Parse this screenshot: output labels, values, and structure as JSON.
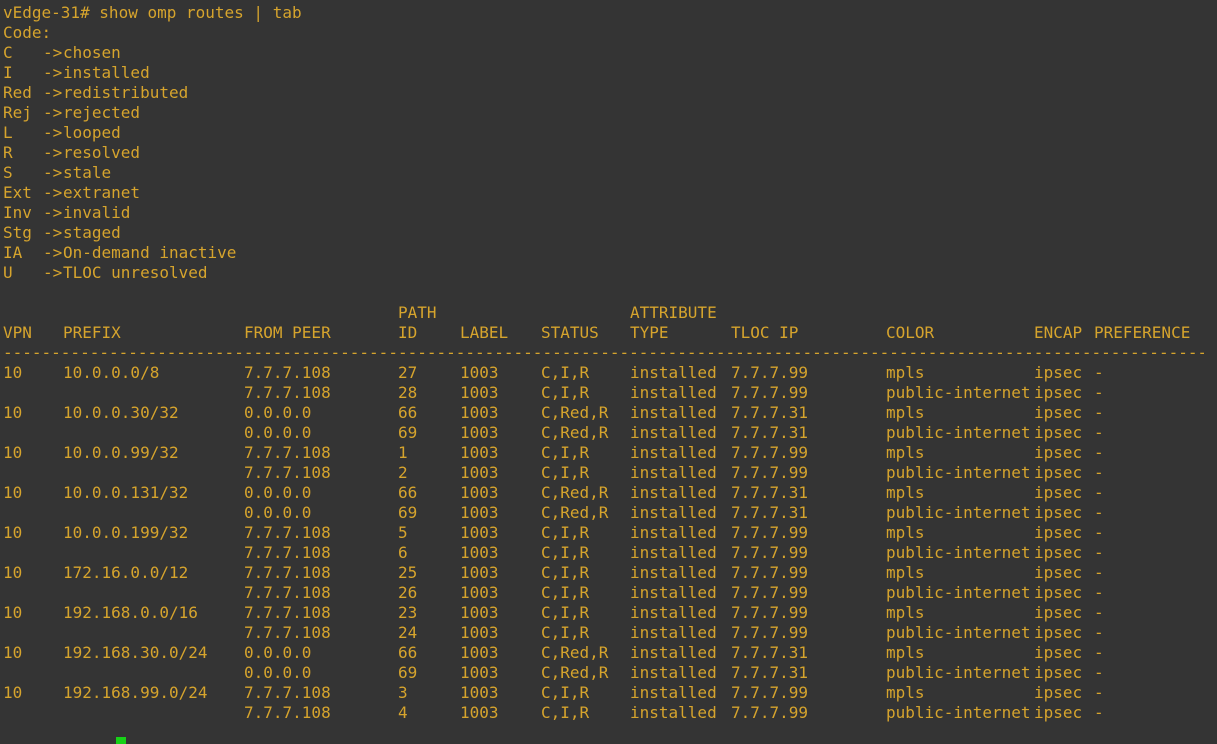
{
  "colors": {
    "background": "#343434",
    "text": "#d6a42d",
    "cursor": "#17d217"
  },
  "terminal": {
    "prompt": "vEdge-31#",
    "command": "show omp routes | tab"
  },
  "legend": {
    "title": "Code:",
    "arrow": "->",
    "entries": [
      {
        "code": "C",
        "meaning": "chosen"
      },
      {
        "code": "I",
        "meaning": "installed"
      },
      {
        "code": "Red",
        "meaning": "redistributed"
      },
      {
        "code": "Rej",
        "meaning": "rejected"
      },
      {
        "code": "L",
        "meaning": "looped"
      },
      {
        "code": "R",
        "meaning": "resolved"
      },
      {
        "code": "S",
        "meaning": "stale"
      },
      {
        "code": "Ext",
        "meaning": "extranet"
      },
      {
        "code": "Inv",
        "meaning": "invalid"
      },
      {
        "code": "Stg",
        "meaning": "staged"
      },
      {
        "code": "IA",
        "meaning": "On-demand inactive"
      },
      {
        "code": "U",
        "meaning": "TLOC unresolved"
      }
    ]
  },
  "table": {
    "header_top": {
      "path": "PATH",
      "attribute": "ATTRIBUTE"
    },
    "headers": {
      "vpn": "VPN",
      "prefix": "PREFIX",
      "from_peer": "FROM PEER",
      "path_id": "ID",
      "label": "LABEL",
      "status": "STATUS",
      "attribute_type": "TYPE",
      "tloc_ip": "TLOC IP",
      "color": "COLOR",
      "encap": "ENCAP",
      "preference": "PREFERENCE"
    },
    "separator_char": "-",
    "rows": [
      {
        "vpn": "10",
        "prefix": "10.0.0.0/8",
        "from_peer": "7.7.7.108",
        "path_id": "27",
        "label": "1003",
        "status": "C,I,R",
        "attribute_type": "installed",
        "tloc_ip": "7.7.7.99",
        "color": "mpls",
        "encap": "ipsec",
        "preference": "-"
      },
      {
        "vpn": "",
        "prefix": "",
        "from_peer": "7.7.7.108",
        "path_id": "28",
        "label": "1003",
        "status": "C,I,R",
        "attribute_type": "installed",
        "tloc_ip": "7.7.7.99",
        "color": "public-internet",
        "encap": "ipsec",
        "preference": "-"
      },
      {
        "vpn": "10",
        "prefix": "10.0.0.30/32",
        "from_peer": "0.0.0.0",
        "path_id": "66",
        "label": "1003",
        "status": "C,Red,R",
        "attribute_type": "installed",
        "tloc_ip": "7.7.7.31",
        "color": "mpls",
        "encap": "ipsec",
        "preference": "-"
      },
      {
        "vpn": "",
        "prefix": "",
        "from_peer": "0.0.0.0",
        "path_id": "69",
        "label": "1003",
        "status": "C,Red,R",
        "attribute_type": "installed",
        "tloc_ip": "7.7.7.31",
        "color": "public-internet",
        "encap": "ipsec",
        "preference": "-"
      },
      {
        "vpn": "10",
        "prefix": "10.0.0.99/32",
        "from_peer": "7.7.7.108",
        "path_id": "1",
        "label": "1003",
        "status": "C,I,R",
        "attribute_type": "installed",
        "tloc_ip": "7.7.7.99",
        "color": "mpls",
        "encap": "ipsec",
        "preference": "-"
      },
      {
        "vpn": "",
        "prefix": "",
        "from_peer": "7.7.7.108",
        "path_id": "2",
        "label": "1003",
        "status": "C,I,R",
        "attribute_type": "installed",
        "tloc_ip": "7.7.7.99",
        "color": "public-internet",
        "encap": "ipsec",
        "preference": "-"
      },
      {
        "vpn": "10",
        "prefix": "10.0.0.131/32",
        "from_peer": "0.0.0.0",
        "path_id": "66",
        "label": "1003",
        "status": "C,Red,R",
        "attribute_type": "installed",
        "tloc_ip": "7.7.7.31",
        "color": "mpls",
        "encap": "ipsec",
        "preference": "-"
      },
      {
        "vpn": "",
        "prefix": "",
        "from_peer": "0.0.0.0",
        "path_id": "69",
        "label": "1003",
        "status": "C,Red,R",
        "attribute_type": "installed",
        "tloc_ip": "7.7.7.31",
        "color": "public-internet",
        "encap": "ipsec",
        "preference": "-"
      },
      {
        "vpn": "10",
        "prefix": "10.0.0.199/32",
        "from_peer": "7.7.7.108",
        "path_id": "5",
        "label": "1003",
        "status": "C,I,R",
        "attribute_type": "installed",
        "tloc_ip": "7.7.7.99",
        "color": "mpls",
        "encap": "ipsec",
        "preference": "-"
      },
      {
        "vpn": "",
        "prefix": "",
        "from_peer": "7.7.7.108",
        "path_id": "6",
        "label": "1003",
        "status": "C,I,R",
        "attribute_type": "installed",
        "tloc_ip": "7.7.7.99",
        "color": "public-internet",
        "encap": "ipsec",
        "preference": "-"
      },
      {
        "vpn": "10",
        "prefix": "172.16.0.0/12",
        "from_peer": "7.7.7.108",
        "path_id": "25",
        "label": "1003",
        "status": "C,I,R",
        "attribute_type": "installed",
        "tloc_ip": "7.7.7.99",
        "color": "mpls",
        "encap": "ipsec",
        "preference": "-"
      },
      {
        "vpn": "",
        "prefix": "",
        "from_peer": "7.7.7.108",
        "path_id": "26",
        "label": "1003",
        "status": "C,I,R",
        "attribute_type": "installed",
        "tloc_ip": "7.7.7.99",
        "color": "public-internet",
        "encap": "ipsec",
        "preference": "-"
      },
      {
        "vpn": "10",
        "prefix": "192.168.0.0/16",
        "from_peer": "7.7.7.108",
        "path_id": "23",
        "label": "1003",
        "status": "C,I,R",
        "attribute_type": "installed",
        "tloc_ip": "7.7.7.99",
        "color": "mpls",
        "encap": "ipsec",
        "preference": "-"
      },
      {
        "vpn": "",
        "prefix": "",
        "from_peer": "7.7.7.108",
        "path_id": "24",
        "label": "1003",
        "status": "C,I,R",
        "attribute_type": "installed",
        "tloc_ip": "7.7.7.99",
        "color": "public-internet",
        "encap": "ipsec",
        "preference": "-"
      },
      {
        "vpn": "10",
        "prefix": "192.168.30.0/24",
        "from_peer": "0.0.0.0",
        "path_id": "66",
        "label": "1003",
        "status": "C,Red,R",
        "attribute_type": "installed",
        "tloc_ip": "7.7.7.31",
        "color": "mpls",
        "encap": "ipsec",
        "preference": "-"
      },
      {
        "vpn": "",
        "prefix": "",
        "from_peer": "0.0.0.0",
        "path_id": "69",
        "label": "1003",
        "status": "C,Red,R",
        "attribute_type": "installed",
        "tloc_ip": "7.7.7.31",
        "color": "public-internet",
        "encap": "ipsec",
        "preference": "-"
      },
      {
        "vpn": "10",
        "prefix": "192.168.99.0/24",
        "from_peer": "7.7.7.108",
        "path_id": "3",
        "label": "1003",
        "status": "C,I,R",
        "attribute_type": "installed",
        "tloc_ip": "7.7.7.99",
        "color": "mpls",
        "encap": "ipsec",
        "preference": "-"
      },
      {
        "vpn": "",
        "prefix": "",
        "from_peer": "7.7.7.108",
        "path_id": "4",
        "label": "1003",
        "status": "C,I,R",
        "attribute_type": "installed",
        "tloc_ip": "7.7.7.99",
        "color": "public-internet",
        "encap": "ipsec",
        "preference": "-"
      }
    ]
  }
}
